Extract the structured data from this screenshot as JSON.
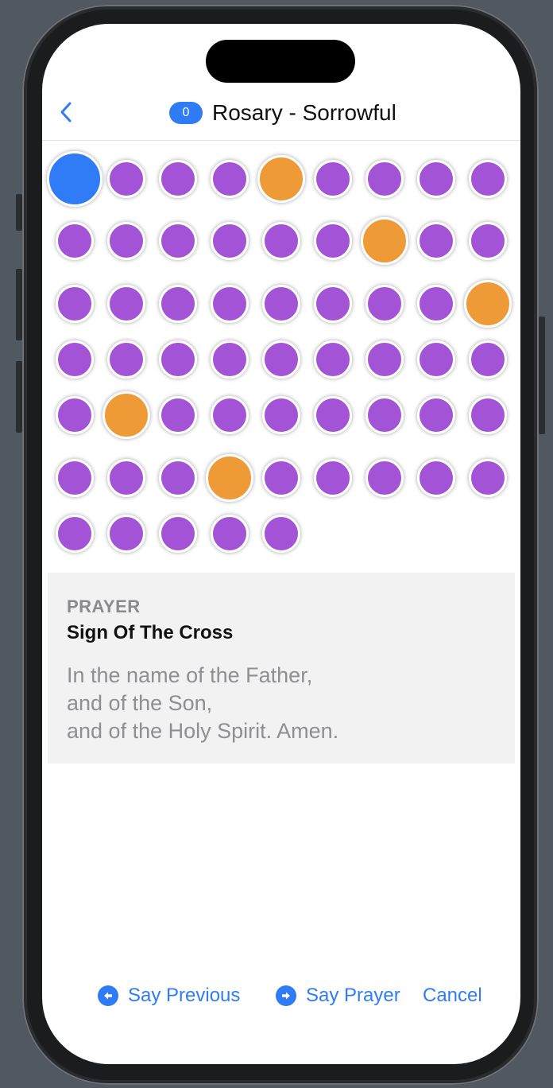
{
  "colors": {
    "accent": "#2f7cf6",
    "bead_current": "#2f7cf6",
    "bead_hail_mary": "#a353d6",
    "bead_our_father": "#ee9a36"
  },
  "nav": {
    "back_icon": "chevron-left-icon",
    "badge_count": "0",
    "title": "Rosary - Sorrowful"
  },
  "beads": {
    "rows": [
      [
        "current",
        "hail-mary",
        "hail-mary",
        "hail-mary",
        "our-father",
        "hail-mary",
        "hail-mary",
        "hail-mary",
        "hail-mary"
      ],
      [
        "hail-mary",
        "hail-mary",
        "hail-mary",
        "hail-mary",
        "hail-mary",
        "hail-mary",
        "our-father",
        "hail-mary",
        "hail-mary"
      ],
      [
        "hail-mary",
        "hail-mary",
        "hail-mary",
        "hail-mary",
        "hail-mary",
        "hail-mary",
        "hail-mary",
        "hail-mary",
        "our-father"
      ],
      [
        "hail-mary",
        "hail-mary",
        "hail-mary",
        "hail-mary",
        "hail-mary",
        "hail-mary",
        "hail-mary",
        "hail-mary",
        "hail-mary"
      ],
      [
        "hail-mary",
        "our-father",
        "hail-mary",
        "hail-mary",
        "hail-mary",
        "hail-mary",
        "hail-mary",
        "hail-mary",
        "hail-mary"
      ],
      [
        "hail-mary",
        "hail-mary",
        "hail-mary",
        "our-father",
        "hail-mary",
        "hail-mary",
        "hail-mary",
        "hail-mary",
        "hail-mary"
      ],
      [
        "hail-mary",
        "hail-mary",
        "hail-mary",
        "hail-mary",
        "hail-mary"
      ]
    ]
  },
  "prayer": {
    "section_label": "PRAYER",
    "name": "Sign Of The Cross",
    "lines": [
      "In the name of the Father,",
      "and of the Son,",
      "and of the Holy Spirit. Amen."
    ]
  },
  "toolbar": {
    "previous_label": "Say Previous",
    "previous_icon": "arrow-left-circle-icon",
    "next_label": "Say Prayer",
    "next_icon": "arrow-right-circle-icon",
    "cancel_label": "Cancel"
  }
}
